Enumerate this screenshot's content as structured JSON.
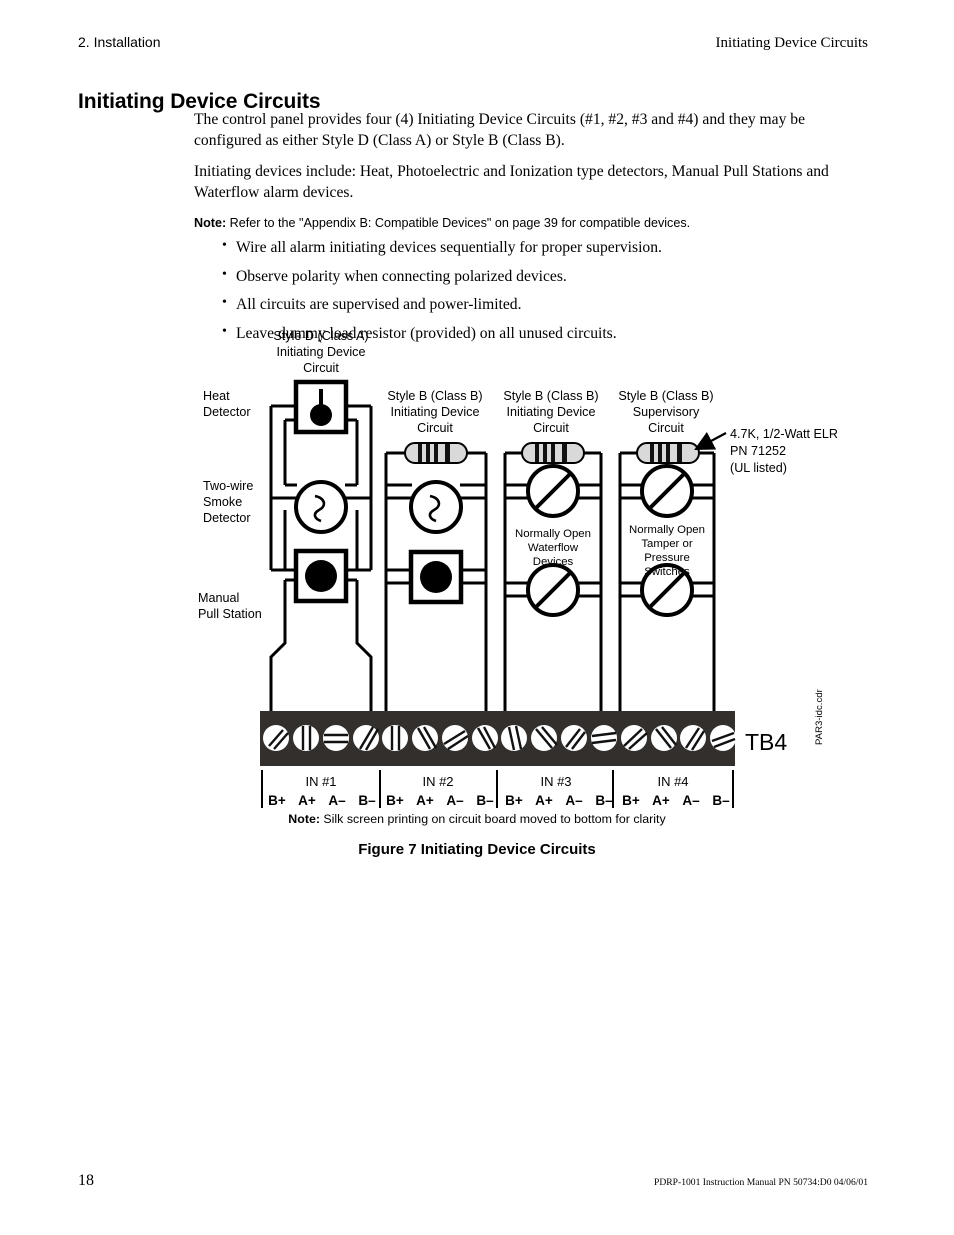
{
  "header": {
    "left": "2. Installation",
    "right": "Initiating Device Circuits"
  },
  "page_title": "Initiating Device Circuits",
  "body": {
    "paragraph_1": "The control panel provides four (4) Initiating Device Circuits (#1, #2, #3 and #4) and they may be configured as either Style D (Class A) or Style B (Class B).",
    "paragraph_2": "Initiating devices include: Heat, Photoelectric and Ionization type detectors, Manual Pull Stations and Waterflow alarm devices.",
    "note_lead": "Note:",
    "note_text": " Refer to the \"Appendix B: Compatible Devices\" on page 39 for compatible devices.",
    "bullets": [
      "Wire all alarm initiating devices sequentially for proper supervision.",
      "Observe polarity when connecting polarized devices.",
      "All circuits are supervised and power-limited.",
      "Leave dummy load resistor (provided) on all unused circuits."
    ]
  },
  "figure": {
    "column_headings": [
      {
        "line1": "Style D (Class A)",
        "line2": "Initiating Device",
        "line3": "Circuit"
      },
      {
        "line1": "Style B (Class B)",
        "line2": "Initiating Device",
        "line3": "Circuit"
      },
      {
        "line1": "Style B (Class B)",
        "line2": "Initiating Device",
        "line3": "Circuit"
      },
      {
        "line1": "Style B (Class B)",
        "line2": "Supervisory",
        "line3": "Circuit"
      }
    ],
    "device_labels": [
      {
        "line1": "Heat",
        "line2": "Detector"
      },
      {
        "line1": "Two-wire",
        "line2": "Smoke",
        "line3": "Detector"
      },
      {
        "line1": "Manual",
        "line2": "Pull Station"
      }
    ],
    "elr_callout": {
      "line1": "4.7K, 1/2-Watt ELR",
      "line2": "PN 71252",
      "line3": "(UL listed)"
    },
    "inline_labels": [
      {
        "line1": "Normally Open",
        "line2": "Waterflow",
        "line3": "Devices"
      },
      {
        "line1": "Normally Open",
        "line2": "Tamper or",
        "line3": "Pressure",
        "line4": "Switches"
      }
    ],
    "terminal_block": {
      "name": "TB4",
      "groups": [
        {
          "title": "IN #1",
          "terminals": [
            "B+",
            "A+",
            "A–",
            "B–"
          ]
        },
        {
          "title": "IN #2",
          "terminals": [
            "B+",
            "A+",
            "A–",
            "B–"
          ]
        },
        {
          "title": "IN #3",
          "terminals": [
            "B+",
            "A+",
            "A–",
            "B–"
          ]
        },
        {
          "title": "IN #4",
          "terminals": [
            "B+",
            "A+",
            "A–",
            "B–"
          ]
        }
      ],
      "screw_count": 16
    },
    "drawing_id": "PAR3-idc.cdr",
    "note_lead": "Note:",
    "note_text": " Silk screen printing on circuit board moved to bottom for clarity",
    "caption": "Figure 7  Initiating Device Circuits"
  },
  "footer": {
    "page_number": "18",
    "doc_id": "PDRP-1001 Instruction Manual  PN 50734:D0  04/06/01"
  },
  "colors": {
    "text": "#000000",
    "terminal_block_fill": "#332f2d",
    "resistor_body": "#d9d9d9",
    "page_background": "#ffffff"
  }
}
